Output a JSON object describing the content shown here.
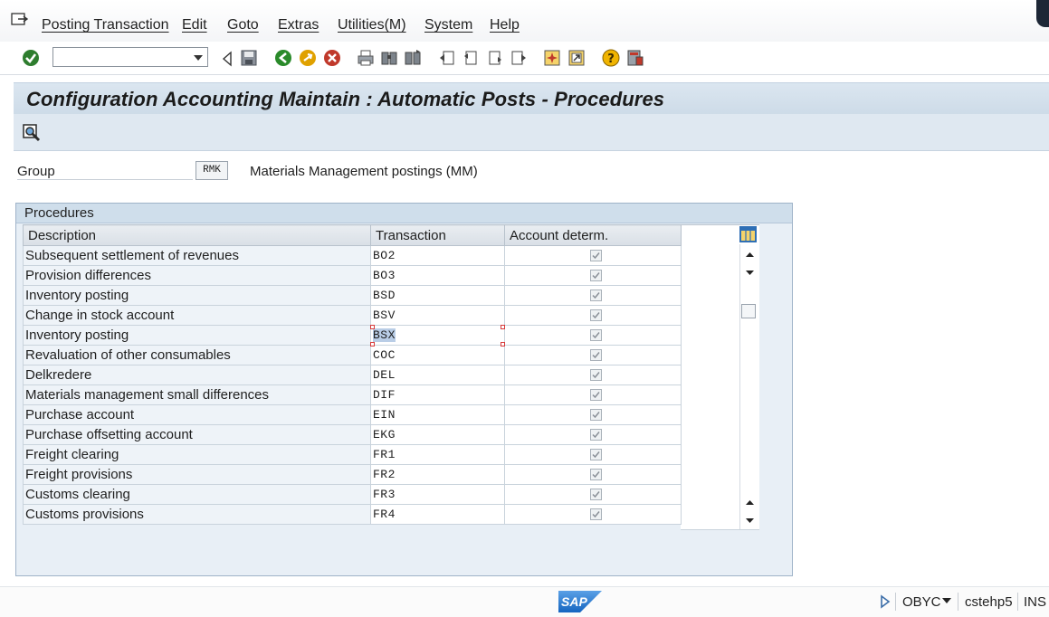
{
  "menu": {
    "items": [
      "Posting Transaction",
      "Edit",
      "Goto",
      "Extras",
      "Utilities(M)",
      "System",
      "Help"
    ]
  },
  "toolbar": {
    "command_value": "",
    "icons": [
      "enter-icon",
      "back-icon",
      "save-icon",
      "back-nav-icon",
      "exit-icon",
      "cancel-icon",
      "print-icon",
      "find-icon",
      "find-next-icon",
      "first-page-icon",
      "previous-page-icon",
      "next-page-icon",
      "last-page-icon",
      "create-session-icon",
      "shortcut-icon",
      "help-icon",
      "layout-menu-icon"
    ]
  },
  "title": "Configuration Accounting Maintain : Automatic Posts - Procedures",
  "group": {
    "label": "Group",
    "value": "RMK",
    "description": "Materials Management postings (MM)"
  },
  "procedures": {
    "title": "Procedures",
    "columns": [
      "Description",
      "Transaction",
      "Account determ."
    ],
    "rows": [
      {
        "description": "Subsequent settlement of revenues",
        "transaction": "BO2",
        "account_determ": true
      },
      {
        "description": "Provision differences",
        "transaction": "BO3",
        "account_determ": true
      },
      {
        "description": "Inventory posting",
        "transaction": "BSD",
        "account_determ": true
      },
      {
        "description": "Change in stock account",
        "transaction": "BSV",
        "account_determ": true
      },
      {
        "description": "Inventory posting",
        "transaction": "BSX",
        "account_determ": true,
        "selected": true
      },
      {
        "description": "Revaluation of other consumables",
        "transaction": "COC",
        "account_determ": true
      },
      {
        "description": "Delkredere",
        "transaction": "DEL",
        "account_determ": true
      },
      {
        "description": "Materials management small differences",
        "transaction": "DIF",
        "account_determ": true
      },
      {
        "description": "Purchase account",
        "transaction": "EIN",
        "account_determ": true
      },
      {
        "description": "Purchase offsetting account",
        "transaction": "EKG",
        "account_determ": true
      },
      {
        "description": "Freight clearing",
        "transaction": "FR1",
        "account_determ": true
      },
      {
        "description": "Freight provisions",
        "transaction": "FR2",
        "account_determ": true
      },
      {
        "description": "Customs clearing",
        "transaction": "FR3",
        "account_determ": true
      },
      {
        "description": "Customs provisions",
        "transaction": "FR4",
        "account_determ": true
      }
    ]
  },
  "status": {
    "transaction": "OBYC",
    "server": "cstehp5",
    "mode": "INS"
  },
  "colors": {
    "title_bg": "#d6e2ed",
    "box_bg": "#e8eff6",
    "selection": "#b9cde6",
    "enter_green": "#2e7d2e",
    "cancel_red": "#c0392b"
  }
}
